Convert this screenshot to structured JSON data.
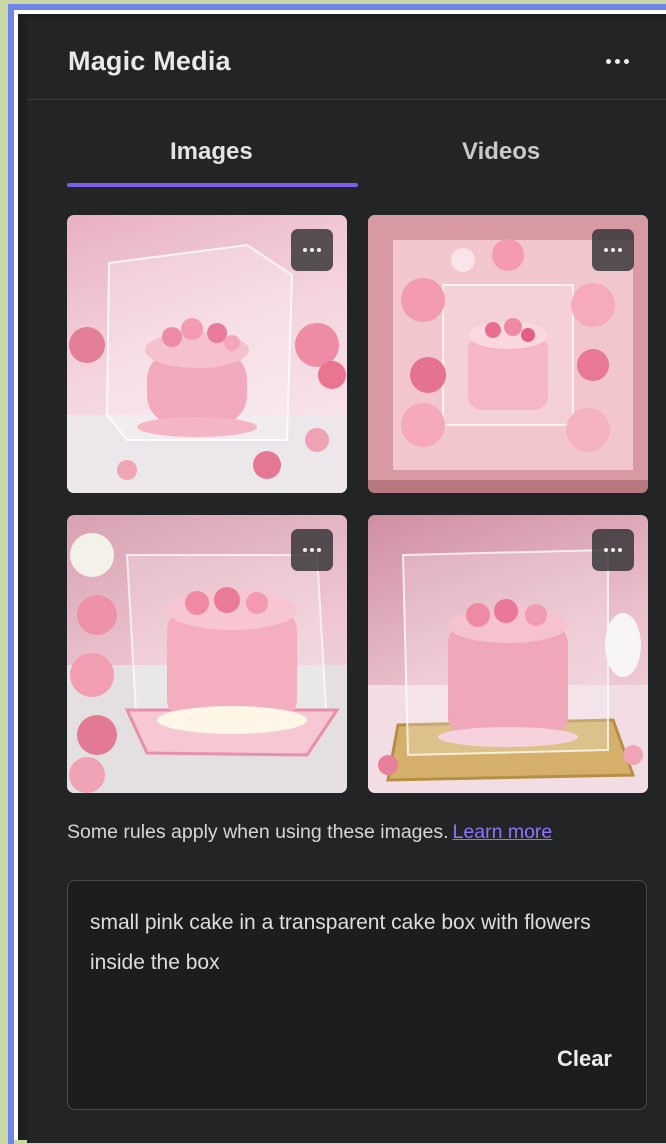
{
  "panel": {
    "title": "Magic Media",
    "more_icon": "more-horizontal-icon"
  },
  "tabs": [
    {
      "label": "Images",
      "selected": true
    },
    {
      "label": "Videos",
      "selected": false
    }
  ],
  "colors": {
    "accent": "#7c5ee8",
    "link": "#8f74ff",
    "panel_bg": "#232425",
    "text": "#e4e4e4"
  },
  "results": [
    {
      "alt": "pink cake in transparent box with flowers",
      "menu_icon": "more-horizontal-icon"
    },
    {
      "alt": "pink cake in pink box surrounded by flowers",
      "menu_icon": "more-horizontal-icon"
    },
    {
      "alt": "pink cake with flowers in acrylic box on pink tray",
      "menu_icon": "more-horizontal-icon"
    },
    {
      "alt": "pink cake with flowers in clear box on gold tray",
      "menu_icon": "more-horizontal-icon"
    }
  ],
  "notice": {
    "text": "Some rules apply when using these images.",
    "link_label": "Learn more"
  },
  "prompt": {
    "value": "small pink cake in a transparent cake box with flowers inside the box",
    "clear_label": "Clear"
  }
}
